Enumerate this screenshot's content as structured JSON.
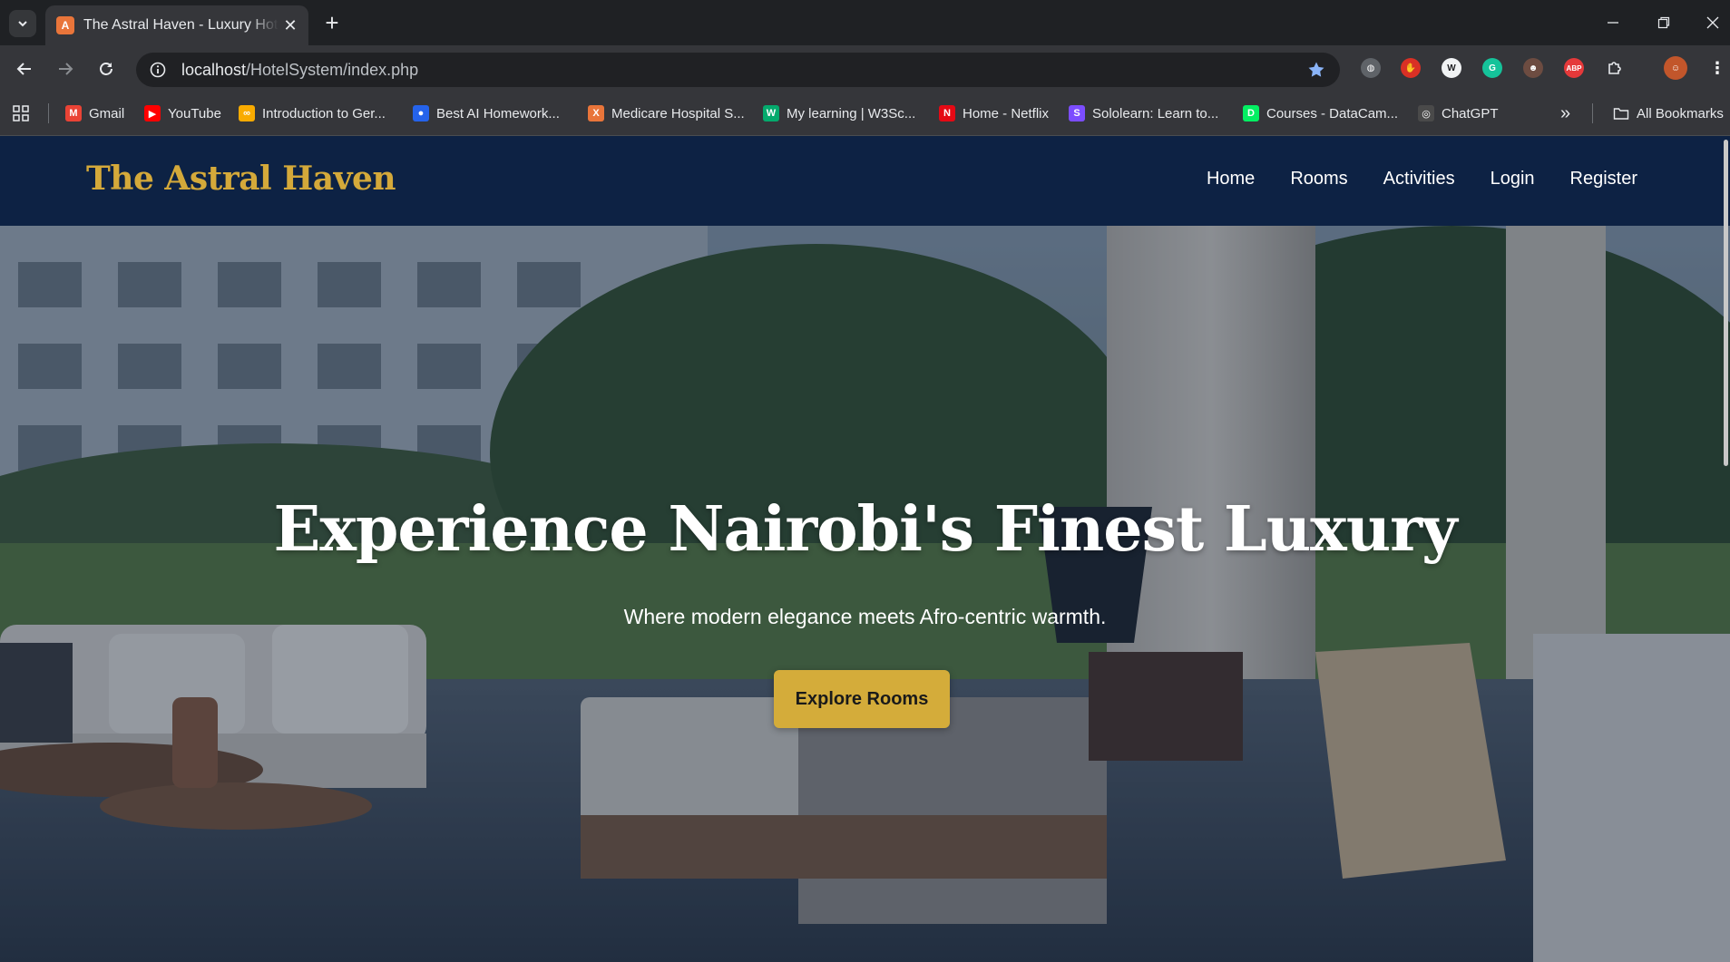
{
  "browser": {
    "tab": {
      "favicon_letter": "A",
      "title": "The Astral Haven - Luxury Hotel",
      "close_glyph": "✕"
    },
    "new_tab_glyph": "+",
    "address": {
      "host": "localhost",
      "path": "/HotelSystem/index.php"
    },
    "bookmarks": [
      {
        "label": "Gmail",
        "icon": "gmail-icon",
        "color": "#ea4335",
        "glyph": "M"
      },
      {
        "label": "YouTube",
        "icon": "youtube-icon",
        "color": "#ff0000",
        "glyph": "▶"
      },
      {
        "label": "Introduction to Ger...",
        "icon": "colab-icon",
        "color": "#f9ab00",
        "glyph": "∞"
      },
      {
        "label": "Best AI Homework...",
        "icon": "ai-homework-icon",
        "color": "#2563eb",
        "glyph": "●"
      },
      {
        "label": "Medicare Hospital S...",
        "icon": "xampp-icon",
        "color": "#e9753a",
        "glyph": "X"
      },
      {
        "label": "My learning | W3Sc...",
        "icon": "w3schools-icon",
        "color": "#04aa6d",
        "glyph": "W"
      },
      {
        "label": "Home - Netflix",
        "icon": "netflix-icon",
        "color": "#e50914",
        "glyph": "N"
      },
      {
        "label": "Sololearn: Learn to...",
        "icon": "sololearn-icon",
        "color": "#7c4dff",
        "glyph": "S"
      },
      {
        "label": "Courses - DataCam...",
        "icon": "datacamp-icon",
        "color": "#03ef62",
        "glyph": "D"
      },
      {
        "label": "ChatGPT",
        "icon": "chatgpt-icon",
        "color": "#4a4a4a",
        "glyph": "◎"
      }
    ],
    "bookmarks_overflow": "»",
    "all_bookmarks": "All Bookmarks"
  },
  "site": {
    "brand": "The Astral Haven",
    "nav": [
      "Home",
      "Rooms",
      "Activities",
      "Login",
      "Register"
    ],
    "hero": {
      "title": "Experience Nairobi's Finest Luxury",
      "subtitle": "Where modern elegance meets Afro-centric warmth.",
      "cta": "Explore Rooms"
    },
    "colors": {
      "navy": "#0d2244",
      "gold": "#d4ac3a",
      "white": "#ffffff"
    }
  }
}
